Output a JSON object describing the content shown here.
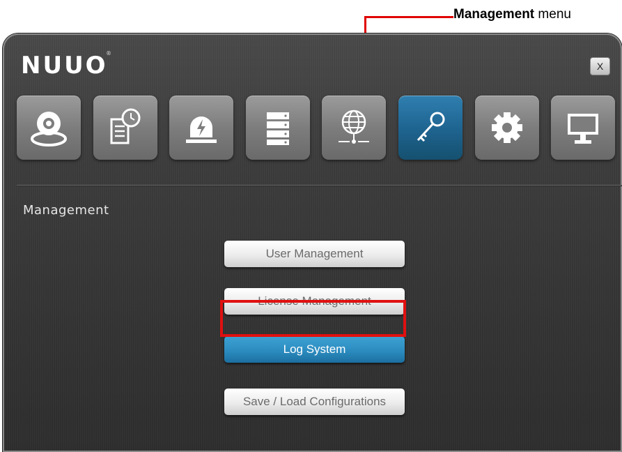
{
  "annotation": {
    "callout_bold": "Management",
    "callout_rest": " menu",
    "callout_color": "#e00000"
  },
  "window": {
    "logo": "NUUO",
    "logo_mark": "®",
    "close_label": "X"
  },
  "toolbar": {
    "tools": [
      {
        "name": "camera-icon",
        "active": false
      },
      {
        "name": "schedule-icon",
        "active": false
      },
      {
        "name": "alarm-icon",
        "active": false
      },
      {
        "name": "storage-icon",
        "active": false
      },
      {
        "name": "network-icon",
        "active": false
      },
      {
        "name": "key-icon",
        "active": true
      },
      {
        "name": "gear-icon",
        "active": false
      },
      {
        "name": "monitor-icon",
        "active": false
      }
    ],
    "active_color": "#1f6592"
  },
  "section": {
    "title": "Management"
  },
  "menu": {
    "items": [
      {
        "label": "User Management",
        "selected": false
      },
      {
        "label": "License Management",
        "selected": false
      },
      {
        "label": "Log System",
        "selected": true
      },
      {
        "label": "Save / Load Configurations",
        "selected": false
      }
    ],
    "selected_color": "#2c8cc0",
    "highlight_color": "#e01010"
  }
}
